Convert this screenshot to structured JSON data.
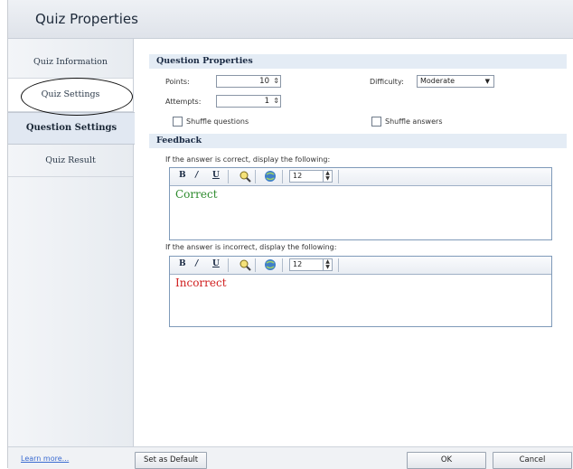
{
  "window": {
    "title": "Quiz Properties"
  },
  "sidebar": {
    "items": [
      {
        "label": "Quiz Information"
      },
      {
        "label": "Quiz Settings"
      },
      {
        "label": "Question Settings"
      },
      {
        "label": "Quiz Result"
      }
    ],
    "active_index": 2
  },
  "question_properties": {
    "header": "Question Properties",
    "points_label": "Points:",
    "points_value": "10",
    "attempts_label": "Attempts:",
    "attempts_value": "1",
    "difficulty_label": "Difficulty:",
    "difficulty_value": "Moderate",
    "shuffle_questions_label": "Shuffle questions",
    "shuffle_answers_label": "Shuffle answers"
  },
  "feedback": {
    "header": "Feedback",
    "correct_prompt": "If the answer is correct, display the following:",
    "correct_text": "Correct",
    "correct_color": "#2e8b2e",
    "incorrect_prompt": "If the answer is incorrect, display the following:",
    "incorrect_text": "Incorrect",
    "incorrect_color": "#d02020",
    "toolbar": {
      "bold": "B",
      "italic": "/",
      "underline": "U",
      "font_size": "12"
    }
  },
  "footer": {
    "learn_more": "Learn more...",
    "set_default": "Set as Default",
    "ok": "OK",
    "cancel": "Cancel"
  }
}
